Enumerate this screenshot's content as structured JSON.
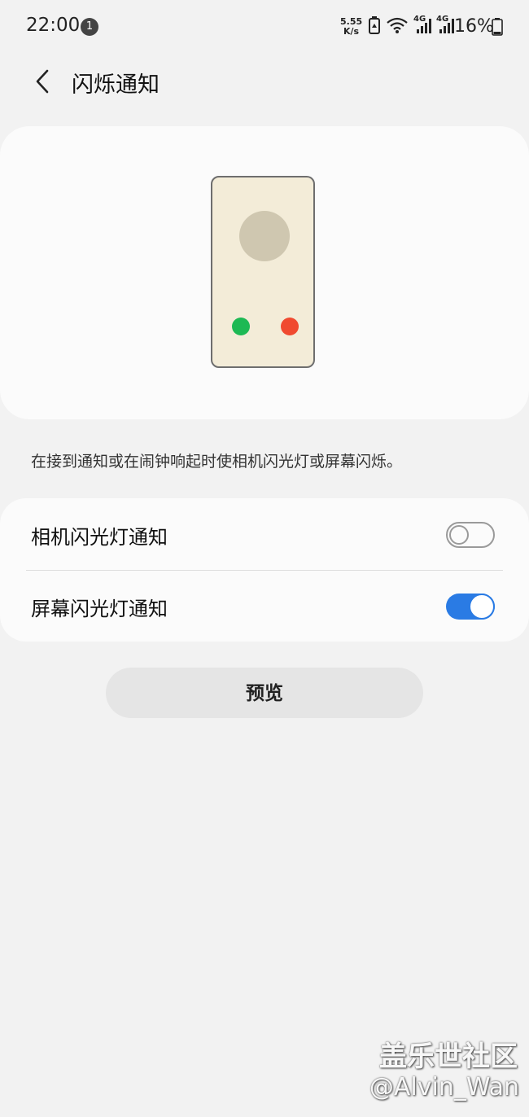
{
  "status_bar": {
    "time": "22:00",
    "notification_count": "1",
    "net_speed_value": "5.55",
    "net_speed_unit": "K/s",
    "signal_1_label": "4G",
    "signal_2_label": "4G",
    "battery_percent": "16%",
    "icons": [
      "battery-saver-icon",
      "wifi-icon",
      "cell-signal-icon",
      "cell-signal-icon",
      "battery-icon"
    ]
  },
  "header": {
    "back_icon": "chevron-left-icon",
    "title": "闪烁通知"
  },
  "illustration": {
    "phone_background": "#f3ecd8",
    "accept_color": "#1db954",
    "decline_color": "#f04a30"
  },
  "description": "在接到通知或在闹钟响起时使相机闪光灯或屏幕闪烁。",
  "settings": [
    {
      "label": "相机闪光灯通知",
      "enabled": false
    },
    {
      "label": "屏幕闪光灯通知",
      "enabled": true
    }
  ],
  "preview_button_label": "预览",
  "watermark": {
    "title": "盖乐世社区",
    "user": "@Alvin_Wan"
  },
  "colors": {
    "background": "#f2f2f2",
    "card": "#fbfbfb",
    "toggle_on": "#2a7be4",
    "toggle_off": "#9a9a9a"
  }
}
